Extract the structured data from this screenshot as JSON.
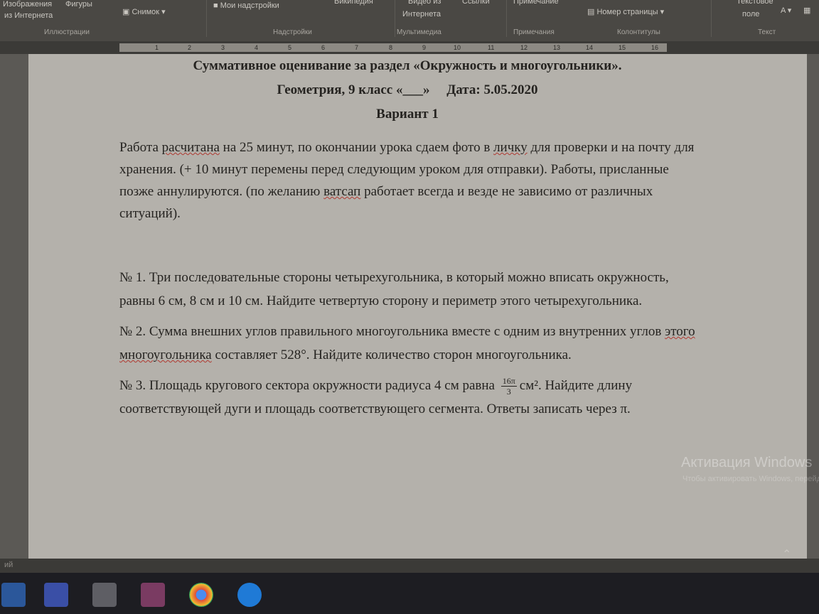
{
  "ribbon": {
    "items": {
      "images": "Изображения",
      "shapes": "Фигуры",
      "online": "из Интернета",
      "screenshot": "Снимок",
      "my_addins": "Мои надстройки",
      "wikipedia": "Википедия",
      "video": "Видео из",
      "video2": "Интернета",
      "links": "Ссылки",
      "comment": "Примечание",
      "page_number": "Номер страницы",
      "textbox": "Текстовое",
      "textbox2": "поле"
    },
    "groups": {
      "illustrations": "Иллюстрации",
      "addins": "Надстройки",
      "media": "Мультимедиа",
      "comments": "Примечания",
      "header_footer": "Колонтитулы",
      "text": "Текст"
    }
  },
  "ruler": {
    "ticks": [
      "1",
      "2",
      "3",
      "4",
      "5",
      "6",
      "7",
      "8",
      "9",
      "10",
      "11",
      "12",
      "13",
      "14",
      "15",
      "16"
    ]
  },
  "document": {
    "title": "Суммативное оценивание за раздел «Окружность и многоугольники».",
    "subtitle_subject": "Геометрия, 9 класс «___»",
    "subtitle_date": "Дата: 5.05.2020",
    "variant": "Вариант 1",
    "intro": {
      "a": "Работа",
      "b": "расчитана",
      "c": "на 25 минут, по окончании урока сдаем фото в",
      "d": "личку",
      "e": "для проверки и на почту для хранения. (+ 10 минут перемены перед следующим уроком для отправки). Работы, присланные позже аннулируются.  (по желанию",
      "f": "ватсап",
      "g": "работает всегда и везде не зависимо от различных ситуаций)."
    },
    "task1": "№ 1. Три последовательные стороны четырехугольника, в который можно вписать окружность, равны 6 см, 8 см и 10 см. Найдите четвертую сторону и периметр этого четырехугольника.",
    "task2": {
      "a": "№ 2. Сумма внешних углов правильного многоугольника вместе с одним из внутренних углов",
      "b": "этого  многоугольника",
      "c": "составляет 528°. Найдите количество сторон многоугольника."
    },
    "task3": {
      "a": "№ 3. Площадь кругового сектора окружности радиуса 4 см равна",
      "frac_num": "16π",
      "frac_den": "3",
      "unit": "см².",
      "b": "Найдите длину соответствующей дуги и площадь соответствующего сегмента. Ответы записать через π."
    }
  },
  "watermark": {
    "title": "Активация Windows",
    "sub": "Чтобы активировать Windows, перейдите в раздел «Параметры»."
  },
  "statusbar": {
    "text": "ий"
  },
  "taskbar": {
    "icons": [
      "word-icon",
      "calculator-icon",
      "winrar-icon",
      "chrome-icon",
      "edge-icon"
    ]
  }
}
